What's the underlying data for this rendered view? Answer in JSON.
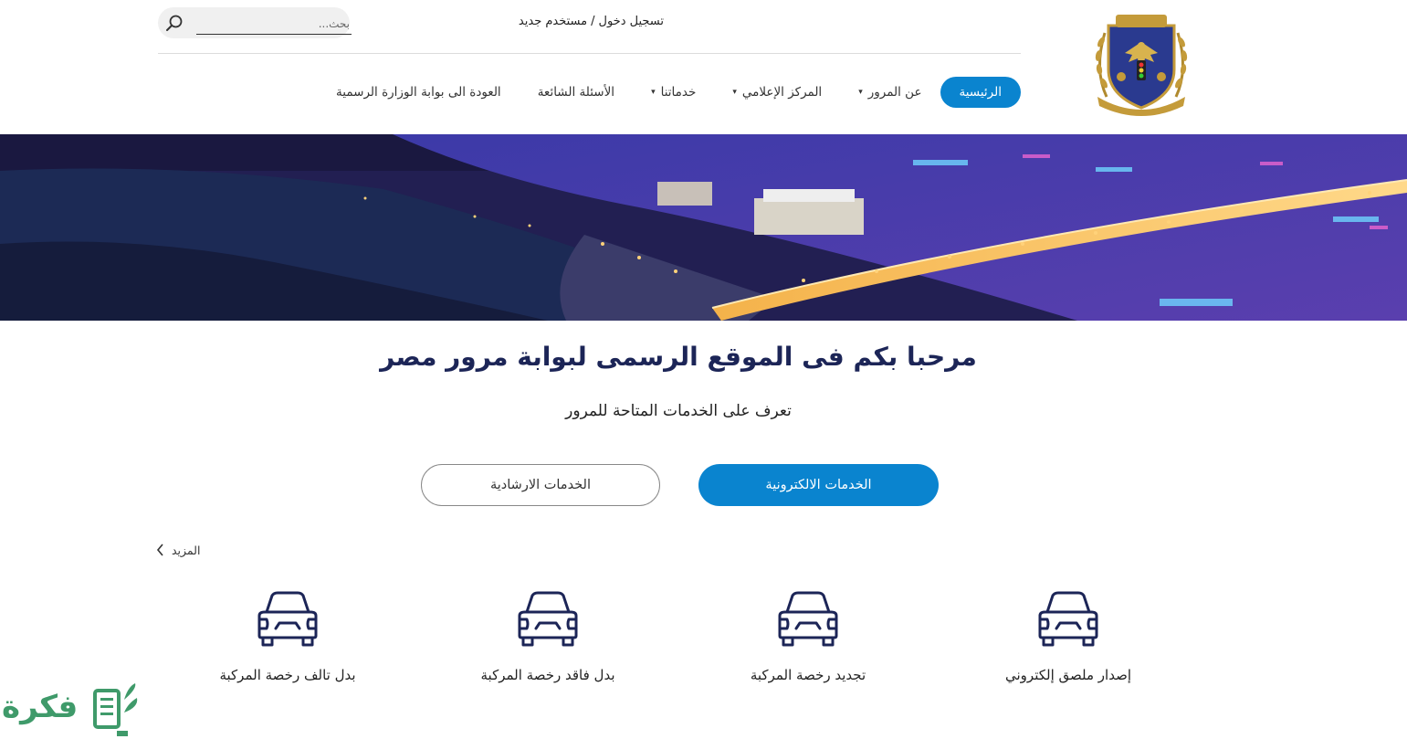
{
  "header": {
    "auth": {
      "login": "تسجيل دخول",
      "separator": "/",
      "register": "مستخدم جديد"
    },
    "search": {
      "placeholder": "بحث..."
    }
  },
  "nav": {
    "items": [
      {
        "label": "الرئيسية",
        "active": true,
        "dropdown": false
      },
      {
        "label": "عن المرور",
        "active": false,
        "dropdown": true
      },
      {
        "label": "المركز الإعلامي",
        "active": false,
        "dropdown": true
      },
      {
        "label": "خدماتنا",
        "active": false,
        "dropdown": true
      },
      {
        "label": "الأسئلة الشائعة",
        "active": false,
        "dropdown": false
      },
      {
        "label": "العودة الى بوابة الوزارة الرسمية",
        "active": false,
        "dropdown": false
      }
    ],
    "caret": "▾"
  },
  "intro": {
    "title": "مرحبا بكم فى الموقع الرسمى لبوابة مرور مصر",
    "subtitle": "تعرف على الخدمات المتاحة للمرور"
  },
  "tabs": {
    "electronic": "الخدمات الالكترونية",
    "guidance": "الخدمات الارشادية"
  },
  "more": {
    "label": "المزيد"
  },
  "services": [
    {
      "label": "إصدار ملصق إلكتروني",
      "icon": "car-icon"
    },
    {
      "label": "تجديد رخصة المركبة",
      "icon": "car-icon"
    },
    {
      "label": "بدل فاقد رخصة المركبة",
      "icon": "car-icon"
    },
    {
      "label": "بدل تالف رخصة المركبة",
      "icon": "car-icon"
    }
  ],
  "watermark": {
    "text": "فكرة"
  },
  "colors": {
    "primary": "#0a84cf",
    "title": "#1c2557",
    "icon": "#1c2557",
    "watermark": "#3f9a6a"
  }
}
